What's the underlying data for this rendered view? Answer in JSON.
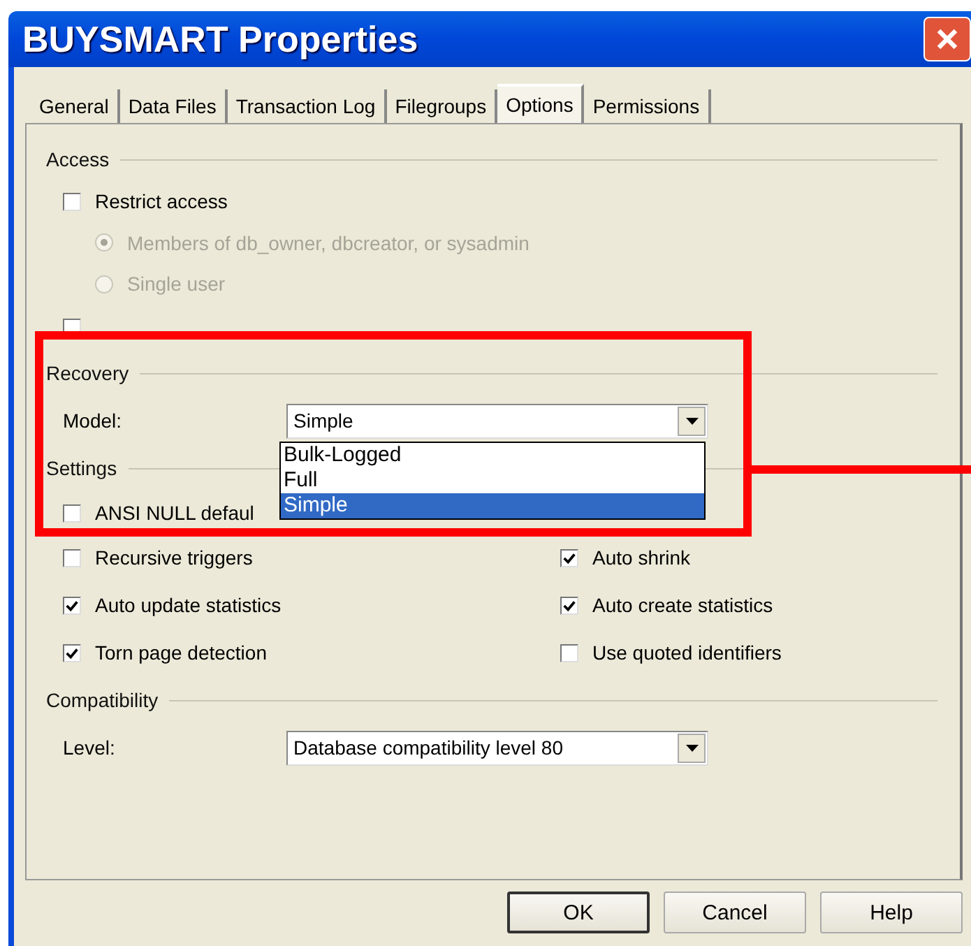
{
  "window": {
    "title": "BUYSMART Properties"
  },
  "tabs": [
    {
      "label": "General",
      "selected": false
    },
    {
      "label": "Data Files",
      "selected": false
    },
    {
      "label": "Transaction Log",
      "selected": false
    },
    {
      "label": "Filegroups",
      "selected": false
    },
    {
      "label": "Options",
      "selected": true
    },
    {
      "label": "Permissions",
      "selected": false
    }
  ],
  "access": {
    "label": "Access",
    "restrict_access": {
      "label": "Restrict access",
      "checked": false
    },
    "radios": [
      {
        "label": "Members of db_owner, dbcreator, or sysadmin",
        "selected": true,
        "disabled": true
      },
      {
        "label": "Single user",
        "selected": false,
        "disabled": true
      }
    ],
    "read_only": {
      "checked": false
    }
  },
  "recovery": {
    "label": "Recovery",
    "model_label": "Model:",
    "model_value": "Simple",
    "options": [
      {
        "label": "Bulk-Logged",
        "selected": false
      },
      {
        "label": "Full",
        "selected": false
      },
      {
        "label": "Simple",
        "selected": true
      }
    ]
  },
  "settings": {
    "label": "Settings",
    "rows": [
      [
        {
          "label": "ANSI NULL defaul",
          "checked": false
        }
      ],
      [
        {
          "label": "Recursive triggers",
          "checked": false
        },
        {
          "label": "Auto shrink",
          "checked": true
        }
      ],
      [
        {
          "label": "Auto update statistics",
          "checked": true
        },
        {
          "label": "Auto create statistics",
          "checked": true
        }
      ],
      [
        {
          "label": "Torn page detection",
          "checked": true
        },
        {
          "label": "Use quoted identifiers",
          "checked": false
        }
      ]
    ]
  },
  "compatibility": {
    "label": "Compatibility",
    "level_label": "Level:",
    "level_value": "Database compatibility level 80"
  },
  "buttons": [
    {
      "label": "OK",
      "default": true
    },
    {
      "label": "Cancel",
      "default": false
    },
    {
      "label": "Help",
      "default": false
    }
  ]
}
